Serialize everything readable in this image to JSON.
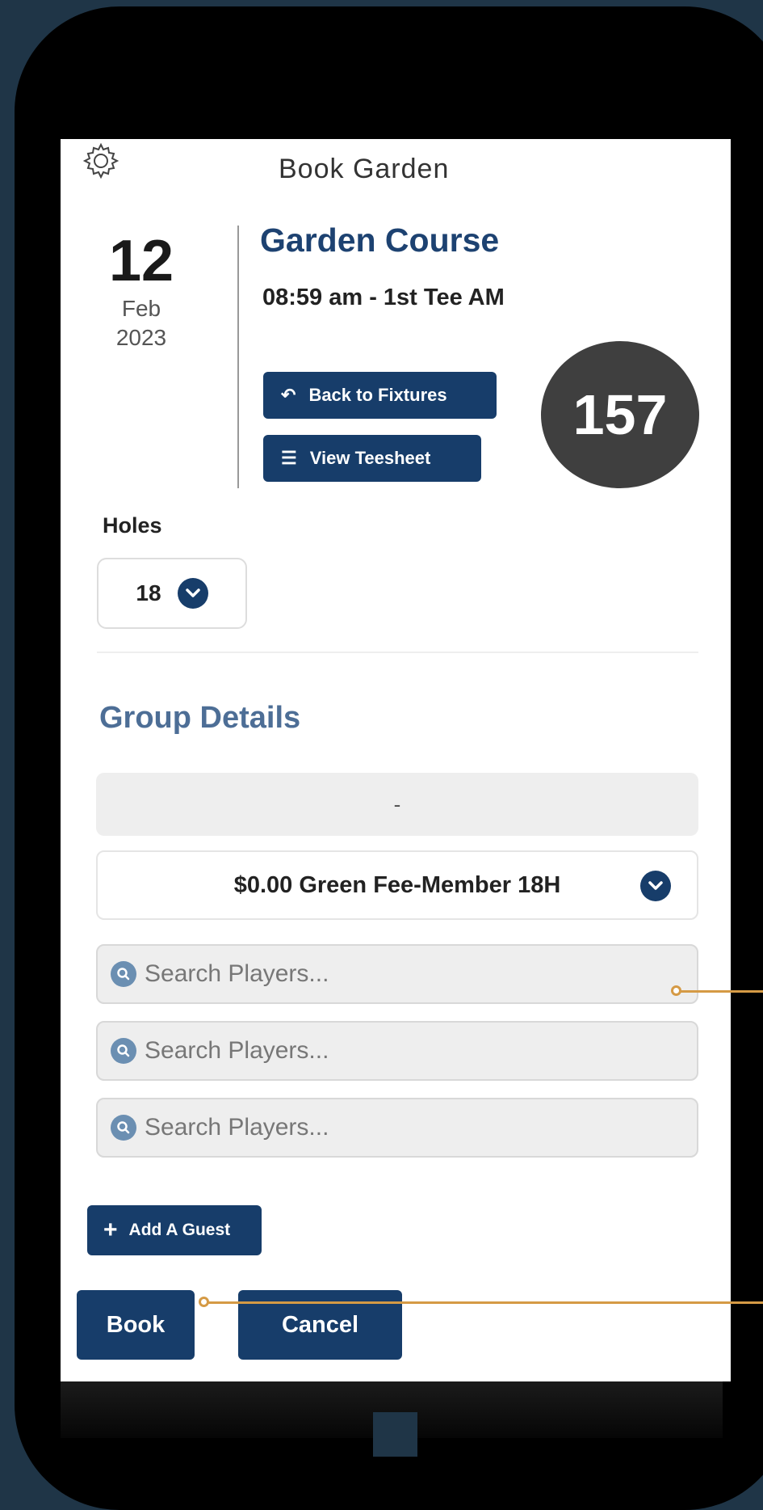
{
  "app": {
    "title": "Book Garden",
    "settings_icon": "gear-icon"
  },
  "booking": {
    "day": "12",
    "month": "Feb",
    "year": "2023",
    "course": "Garden Course",
    "tee_time": "08:59 am - 1st Tee AM",
    "count": "157"
  },
  "nav_buttons": {
    "back_label": "Back to Fixtures",
    "back_icon": "undo-arrow-icon",
    "teesheet_label": "View Teesheet",
    "teesheet_icon": "list-icon"
  },
  "holes": {
    "label": "Holes",
    "value": "18",
    "icon": "chevron-down-icon"
  },
  "group": {
    "title": "Group Details",
    "first_slot_text": "-",
    "fee_value": "$0.00 Green Fee-Member 18H",
    "search_placeholder": "Search Players...",
    "search_icon": "search-icon"
  },
  "actions": {
    "add_guest_label": "Add A Guest",
    "add_guest_icon": "plus-icon",
    "book_label": "Book",
    "cancel_label": "Cancel"
  },
  "colors": {
    "primary": "#173d6a",
    "heading_blue": "#1d4271",
    "group_title": "#4d6e96",
    "callout": "#d59a45",
    "background": "#1f3547",
    "badge": "#3f3f3f"
  }
}
